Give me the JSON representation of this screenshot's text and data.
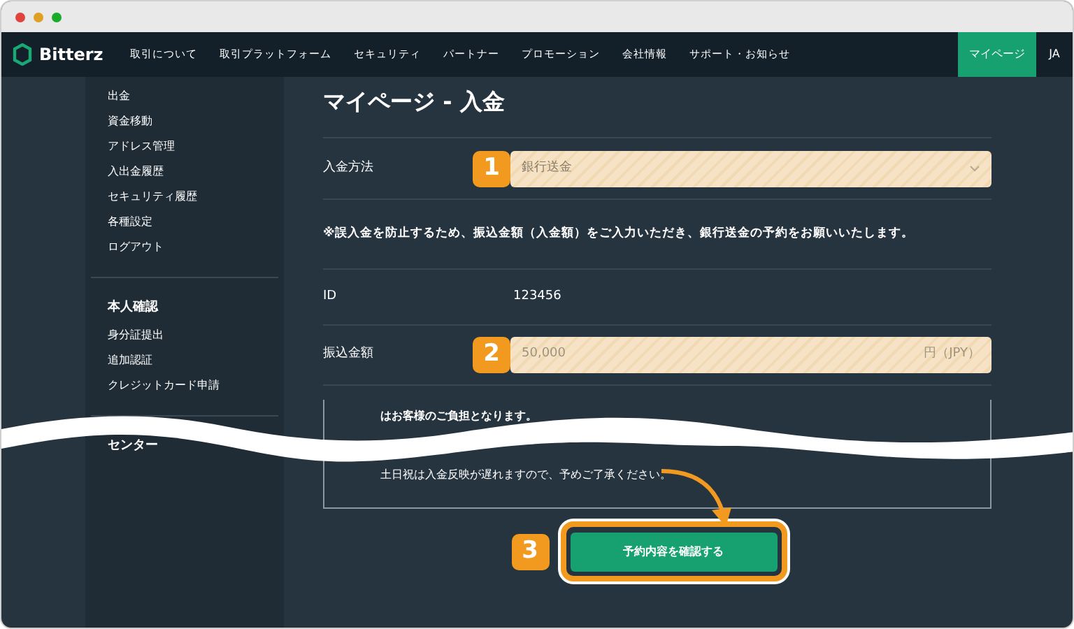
{
  "logo": {
    "text": "Bitterz"
  },
  "nav": [
    {
      "label": "取引について"
    },
    {
      "label": "取引プラットフォーム"
    },
    {
      "label": "セキュリティ"
    },
    {
      "label": "パートナー"
    },
    {
      "label": "プロモーション"
    },
    {
      "label": "会社情報"
    },
    {
      "label": "サポート・お知らせ"
    }
  ],
  "mypage_button": "マイページ",
  "language": "JA",
  "sidebar": {
    "groups": [
      {
        "items": [
          "出金",
          "資金移動",
          "アドレス管理",
          "入出金履歴",
          "セキュリティ履歴",
          "各種設定",
          "ログアウト"
        ]
      },
      {
        "heading": "本人確認",
        "items": [
          "身分証提出",
          "追加認証",
          "クレジットカード申請"
        ]
      },
      {
        "heading": "センター"
      }
    ]
  },
  "page_title": "マイページ - 入金",
  "form": {
    "rows": [
      {
        "kind": "select",
        "label": "入金方法",
        "step": "1",
        "value": "銀行送金"
      },
      {
        "kind": "notice",
        "text": "※誤入金を防止するため、振込金額（入金額）をご入力いただき、銀行送金の予約をお願いいたします。"
      },
      {
        "kind": "static",
        "label": "ID",
        "value": "123456"
      },
      {
        "kind": "input",
        "label": "振込金額",
        "step": "2",
        "placeholder": "50,000",
        "unit": "円（JPY）"
      }
    ]
  },
  "notes": [
    "はお客様のご負担となります。",
    "土日祝は入金反映が遅れますので、予めご了承ください。"
  ],
  "confirm": {
    "step": "3",
    "label": "予約内容を確認する"
  }
}
